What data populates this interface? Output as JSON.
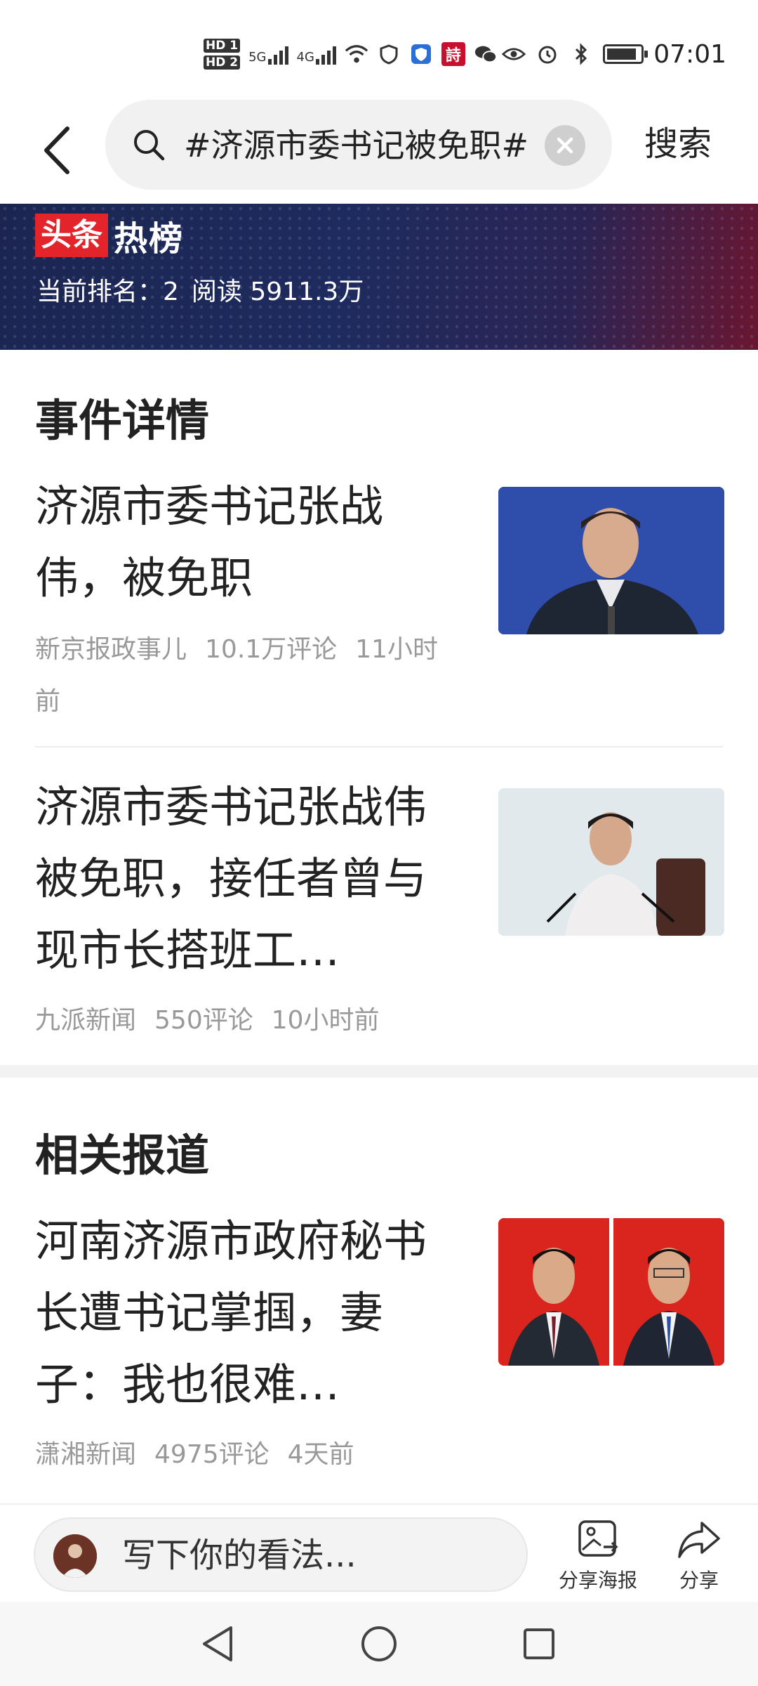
{
  "status_bar": {
    "hd1": "HD 1",
    "hd2": "HD 2",
    "net1": "5G",
    "net2": "4G",
    "poem_badge": "詩",
    "battery_level": 0.9,
    "time": "07:01",
    "icons": [
      "signal-icon",
      "wifi-icon",
      "security-icon",
      "shield-icon",
      "wechat-icon",
      "eye-icon",
      "alarm-icon",
      "bluetooth-icon",
      "battery-icon"
    ]
  },
  "search": {
    "query": "#济源市委书记被免职#",
    "button": "搜索"
  },
  "banner": {
    "logo_red": "头条",
    "logo_white": "热榜",
    "rank": "当前排名：2",
    "reads": "阅读 5911.3万"
  },
  "event_details": {
    "heading": "事件详情",
    "articles": [
      {
        "title": "济源市委书记张战伟，被免职",
        "source": "新京报政事儿",
        "comments": "10.1万评论",
        "time": "11小时前"
      },
      {
        "title": "济源市委书记张战伟被免职，接任者曾与现市长搭班工…",
        "source": "九派新闻",
        "comments": "550评论",
        "time": "10小时前"
      }
    ]
  },
  "related": {
    "heading": "相关报道",
    "articles": [
      {
        "title": "河南济源市政府秘书长遭书记掌掴，妻子：我也很难…",
        "source": "潇湘新闻",
        "comments": "4975评论",
        "time": "4天前"
      }
    ]
  },
  "bottom_bar": {
    "comment_placeholder": "写下你的看法...",
    "share_poster": "分享海报",
    "share": "分享"
  },
  "colors": {
    "brand_red": "#e3242b",
    "banner_navy": "#1e2b5e",
    "meta_gray": "#999999"
  }
}
